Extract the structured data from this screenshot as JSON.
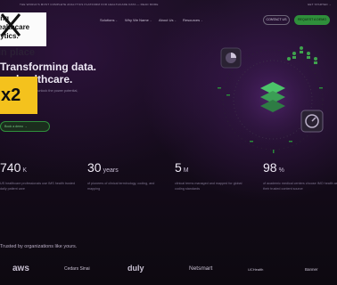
{
  "announcement": {
    "left": "THE WORLD'S MOST COMPLETE ANALYTICS PLATFORM FOR HEALTHCARE DATA — READ MORE",
    "right": "GET STARTED →"
  },
  "nav": {
    "items": [
      {
        "label": "Solutions"
      },
      {
        "label": "Why We Name"
      },
      {
        "label": "About Us"
      },
      {
        "label": "Resources"
      }
    ],
    "contact_label": "CONTACT US",
    "demo_label": "REQUEST A DEMO"
  },
  "logo_overlay": {
    "lines": [
      "ing",
      "ealthcare",
      "lytics."
    ]
  },
  "hero": {
    "sub": "in place",
    "title_line1": "Transforming data.",
    "title_line2": "ng healthcare.",
    "paragraph": "logy to unlock the power potential,",
    "badge": "x2",
    "cta": "Book a demo  →"
  },
  "stats": [
    {
      "num": "740",
      "unit": "K",
      "desc": "US healthcare professionals use IMS health trusted daily patient care"
    },
    {
      "num": "30",
      "unit": "years",
      "desc": "of pioneers of clinical terminology, coding, and mapping"
    },
    {
      "num": "5",
      "unit": "M",
      "desc": "clinical terms managed and mapped for global coding standards"
    },
    {
      "num": "98",
      "unit": "%",
      "desc": "of academic medical centers choose IMO health as their trusted content source"
    }
  ],
  "trusted": "Trusted by organizations like yours.",
  "partner_logos": [
    "aws",
    "Cedars Sinai",
    "duly",
    "Netsmart",
    "UCHealth",
    "Banner"
  ]
}
